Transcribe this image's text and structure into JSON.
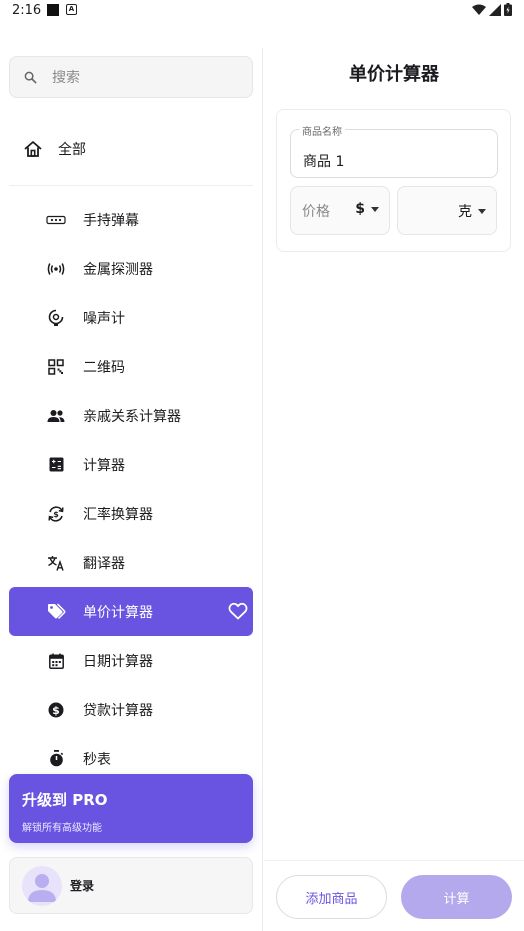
{
  "status_bar": {
    "time": "2:16"
  },
  "sidebar": {
    "search_placeholder": "搜索",
    "all_label": "全部",
    "items": [
      {
        "label": "手持弹幕",
        "icon": "marquee-icon"
      },
      {
        "label": "金属探测器",
        "icon": "sensor-icon"
      },
      {
        "label": "噪声计",
        "icon": "noise-meter-icon"
      },
      {
        "label": "二维码",
        "icon": "qr-code-icon"
      },
      {
        "label": "亲戚关系计算器",
        "icon": "people-icon"
      },
      {
        "label": "计算器",
        "icon": "calculator-icon"
      },
      {
        "label": "汇率换算器",
        "icon": "currency-exchange-icon"
      },
      {
        "label": "翻译器",
        "icon": "translate-icon"
      },
      {
        "label": "单价计算器",
        "icon": "tag-icon",
        "active": true
      },
      {
        "label": "日期计算器",
        "icon": "calendar-icon"
      },
      {
        "label": "贷款计算器",
        "icon": "dollar-circle-icon"
      },
      {
        "label": "秒表",
        "icon": "stopwatch-icon"
      }
    ],
    "upgrade": {
      "title": "升级到 PRO",
      "subtitle": "解锁所有高级功能"
    },
    "login_label": "登录"
  },
  "main": {
    "title": "单价计算器",
    "product": {
      "name_label": "商品名称",
      "name_value": "商品 1",
      "price_placeholder": "价格",
      "currency": "$",
      "unit": "克"
    },
    "add_button": "添加商品",
    "calc_button": "计算"
  },
  "colors": {
    "accent": "#6854e0",
    "accent_disabled": "#b3a9ec"
  }
}
